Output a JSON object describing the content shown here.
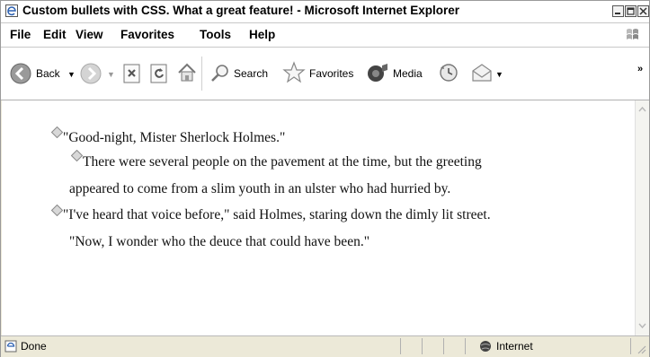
{
  "window": {
    "title": "Custom bullets with CSS. What a great feature! - Microsoft Internet Explorer"
  },
  "menu": {
    "items": [
      "File",
      "Edit",
      "View",
      "Favorites",
      "Tools",
      "Help"
    ]
  },
  "toolbar": {
    "back_label": "Back",
    "search_label": "Search",
    "favorites_label": "Favorites",
    "media_label": "Media",
    "overflow": "»"
  },
  "content": {
    "lines": [
      "\"Good-night, Mister Sherlock Holmes.\"",
      "There were several people on the pavement at the time, but the greeting",
      "appeared to come from a slim youth in an ulster who had hurried by.",
      "\"I've heard that voice before,\" said Holmes, staring down the dimly lit street.",
      "\"Now, I wonder who the deuce that could have been.\""
    ],
    "bullet_icon": "diamond-bullet-icon"
  },
  "statusbar": {
    "status": "Done",
    "zone": "Internet"
  },
  "colors": {
    "chrome": "#ece9d8",
    "bullet_fill": "#d8d8d8",
    "bullet_stroke": "#8a8a8a",
    "back_icon": "#2e9a2e"
  }
}
